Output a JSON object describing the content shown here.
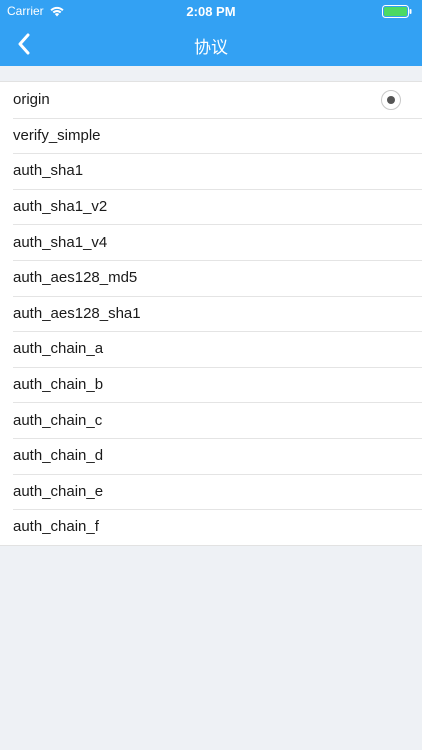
{
  "status_bar": {
    "carrier": "Carrier",
    "time": "2:08 PM",
    "wifi_icon": "wifi-icon",
    "battery_icon": "battery-icon"
  },
  "nav": {
    "title": "协议",
    "back_icon": "chevron-left-icon"
  },
  "colors": {
    "header": "#33a1f3",
    "background": "#eef1f5",
    "battery_fill": "#4cd964"
  },
  "protocols": {
    "selected": "origin",
    "items": [
      "origin",
      "verify_simple",
      "auth_sha1",
      "auth_sha1_v2",
      "auth_sha1_v4",
      "auth_aes128_md5",
      "auth_aes128_sha1",
      "auth_chain_a",
      "auth_chain_b",
      "auth_chain_c",
      "auth_chain_d",
      "auth_chain_e",
      "auth_chain_f"
    ]
  }
}
